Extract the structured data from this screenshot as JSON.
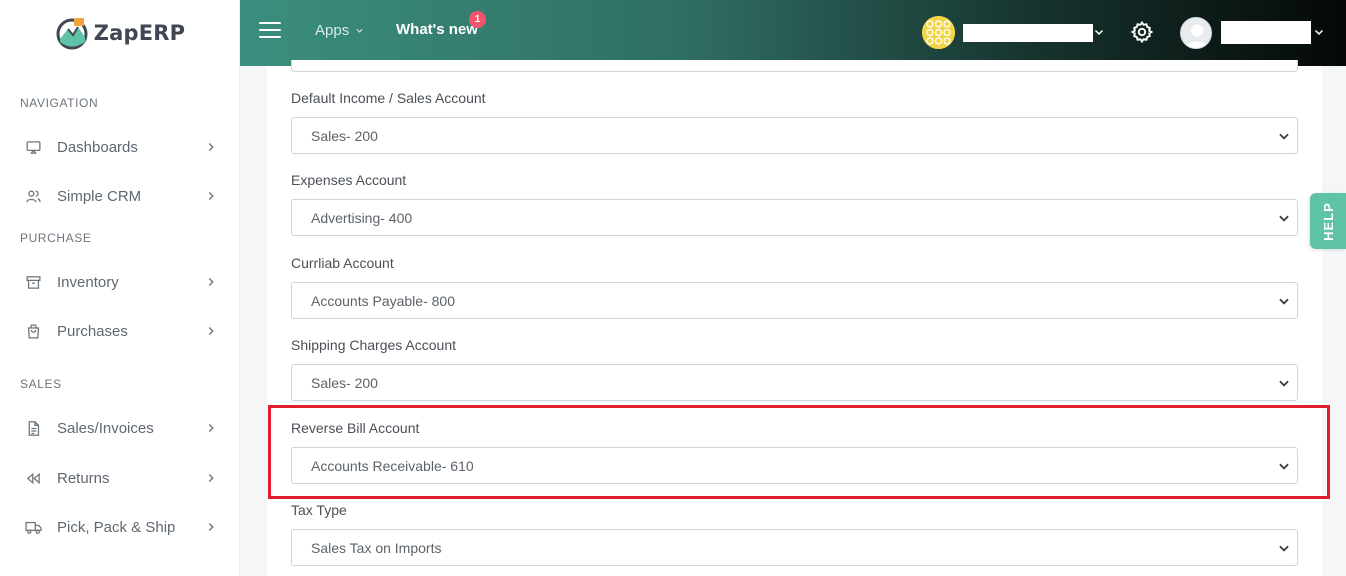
{
  "brand": {
    "name": "ZapERP"
  },
  "header": {
    "apps_label": "Apps",
    "whats_new_label": "What's new",
    "whats_new_badge": "1"
  },
  "sidebar": {
    "sections": [
      {
        "title": "NAVIGATION"
      },
      {
        "title": "PURCHASE"
      },
      {
        "title": "SALES"
      }
    ],
    "items": [
      {
        "label": "Dashboards",
        "icon": "monitor-icon"
      },
      {
        "label": "Simple CRM",
        "icon": "users-icon"
      },
      {
        "label": "Inventory",
        "icon": "archive-icon"
      },
      {
        "label": "Purchases",
        "icon": "shopping-bag-icon"
      },
      {
        "label": "Sales/Invoices",
        "icon": "file-text-icon"
      },
      {
        "label": "Returns",
        "icon": "rewind-icon"
      },
      {
        "label": "Pick, Pack & Ship",
        "icon": "truck-icon"
      }
    ]
  },
  "form": {
    "fields": [
      {
        "label": "Default Income / Sales Account",
        "value": "Sales- 200"
      },
      {
        "label": "Expenses Account",
        "value": "Advertising- 400"
      },
      {
        "label": "Currliab Account",
        "value": "Accounts Payable- 800"
      },
      {
        "label": "Shipping Charges Account",
        "value": "Sales- 200"
      },
      {
        "label": "Reverse Bill Account",
        "value": "Accounts Receivable- 610"
      },
      {
        "label": "Tax Type",
        "value": "Sales Tax on Imports"
      }
    ]
  },
  "help_tab": {
    "label": "HELP"
  },
  "colors": {
    "header_start": "#3b8f7e",
    "header_end": "#050807",
    "highlight": "#e21d2c",
    "help_tab": "#5fc3a8",
    "badge": "#f1556c"
  }
}
